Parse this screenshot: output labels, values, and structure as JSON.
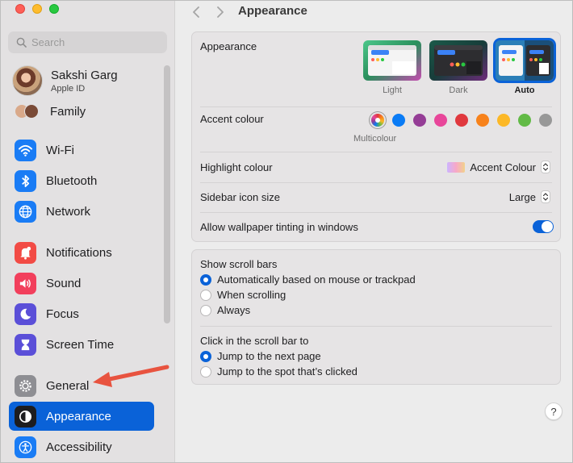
{
  "window": {
    "title": "Appearance"
  },
  "search": {
    "placeholder": "Search"
  },
  "user": {
    "name": "Sakshi Garg",
    "subtitle": "Apple ID"
  },
  "family": {
    "label": "Family"
  },
  "sidebar": {
    "items": [
      {
        "label": "Wi-Fi",
        "icon": "wifi-icon",
        "color": "#1a7cf5"
      },
      {
        "label": "Bluetooth",
        "icon": "bluetooth-icon",
        "color": "#1a7cf5"
      },
      {
        "label": "Network",
        "icon": "globe-icon",
        "color": "#1a7cf5"
      },
      {
        "label": "Notifications",
        "icon": "bell-icon",
        "color": "#f24b45"
      },
      {
        "label": "Sound",
        "icon": "speaker-icon",
        "color": "#f23f5c"
      },
      {
        "label": "Focus",
        "icon": "moon-icon",
        "color": "#5b4fd8"
      },
      {
        "label": "Screen Time",
        "icon": "hourglass-icon",
        "color": "#5b4fd8"
      },
      {
        "label": "General",
        "icon": "gear-icon",
        "color": "#8e8e93"
      },
      {
        "label": "Appearance",
        "icon": "appearance-icon",
        "color": "#1d1d1f",
        "selected": true
      },
      {
        "label": "Accessibility",
        "icon": "accessibility-icon",
        "color": "#1a7cf5"
      }
    ]
  },
  "appearance": {
    "label": "Appearance",
    "options": [
      {
        "label": "Light",
        "selected": false
      },
      {
        "label": "Dark",
        "selected": false
      },
      {
        "label": "Auto",
        "selected": true
      }
    ]
  },
  "accent": {
    "label": "Accent colour",
    "selected_caption": "Multicolour",
    "colors": [
      "multicolour",
      "#0a7bf5",
      "#953d96",
      "#e8469a",
      "#e0383e",
      "#f7821b",
      "#fcb827",
      "#62ba46",
      "#989898"
    ]
  },
  "highlight": {
    "label": "Highlight colour",
    "value": "Accent Colour"
  },
  "sidebar_icon_size": {
    "label": "Sidebar icon size",
    "value": "Large"
  },
  "wallpaper_tinting": {
    "label": "Allow wallpaper tinting in windows",
    "enabled": true
  },
  "scroll_bars": {
    "label": "Show scroll bars",
    "options": [
      {
        "label": "Automatically based on mouse or trackpad",
        "selected": true
      },
      {
        "label": "When scrolling",
        "selected": false
      },
      {
        "label": "Always",
        "selected": false
      }
    ]
  },
  "scroll_click": {
    "label": "Click in the scroll bar to",
    "options": [
      {
        "label": "Jump to the next page",
        "selected": true
      },
      {
        "label": "Jump to the spot that’s clicked",
        "selected": false
      }
    ]
  },
  "help": {
    "label": "?"
  },
  "colors": {
    "selection": "#0a62d8",
    "annotation_arrow": "#e8533f"
  }
}
